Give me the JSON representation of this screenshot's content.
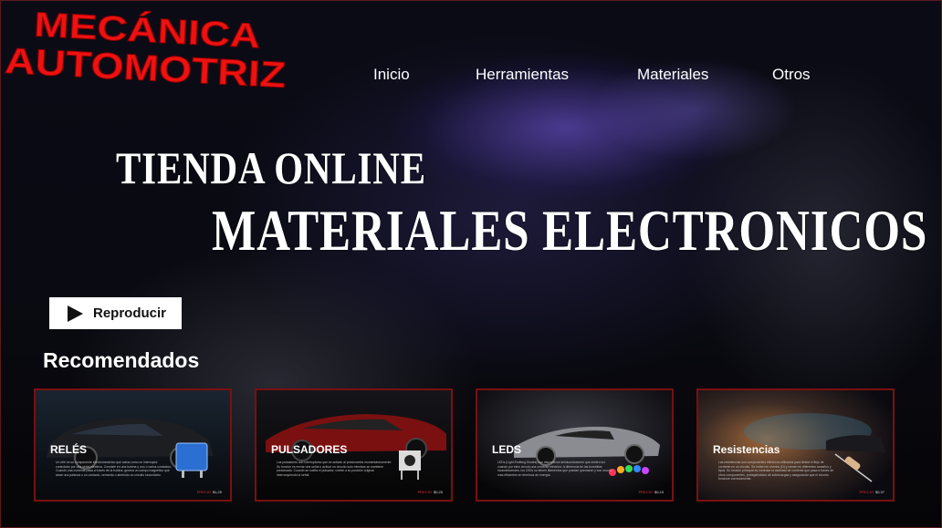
{
  "brand": {
    "line1": "MECÁNICA",
    "line2": "AUTOMOTRIZ",
    "color": "#ee1111"
  },
  "nav": {
    "items": [
      "Inicio",
      "Herramientas",
      "Materiales",
      "Otros"
    ]
  },
  "hero": {
    "line1": "TIENDA ONLINE",
    "line2": "MATERIALES ELECTRONICOS",
    "play_label": "Reproducir",
    "play_icon": "play-icon"
  },
  "recommended": {
    "title": "Recomendados",
    "cards": [
      {
        "title": "RELÉS",
        "desc": "Un relé es un componente electromecánico que actúa como un interruptor controlado por una señal eléctrica. Consiste en una bobina y uno o varios contactos. Cuando una corriente pasa a través de la bobina, genera un campo magnético que atrae una palanca o un contacto, cerrando o abriendo un circuito secundario.",
        "price_label": "PRECIO",
        "price": "$1,25"
      },
      {
        "title": "PULSADORES",
        "desc": "Los pulsadores son interruptores que se activan al presionarlos momentáneamente. Su función es enviar una señal o activar un circuito solo mientras se mantiene presionado. Cuando se suelta el pulsador, vuelve a su posición original interrumpiendo la señal.",
        "price_label": "PRECIO",
        "price": "$0,25"
      },
      {
        "title": "LEDS",
        "desc": "LEDs (Light Emitting Diodes) son dispositivos semiconductores que emiten luz cuando por ellos circula una corriente eléctrica. A diferencia de las bombillas incandescentes, los LEDs no tienen filamentos que puedan quemarse y son mucho más eficientes en términos de energía.",
        "price_label": "PRECIO",
        "price": "$0,15"
      },
      {
        "title": "Resistencias",
        "desc": "Las resistencias son componentes eléctricos utilizados para limitar el flujo de corriente en un circuito. Se miden en ohmios (Ω) y vienen en diferentes tamaños y tipos. Su función principal es controlar la cantidad de corriente que pasa a través de otros componentes, protegiéndolos de sobrecargas y asegurando que el circuito funcione correctamente.",
        "price_label": "PRECIO",
        "price": "$0,37"
      }
    ]
  }
}
